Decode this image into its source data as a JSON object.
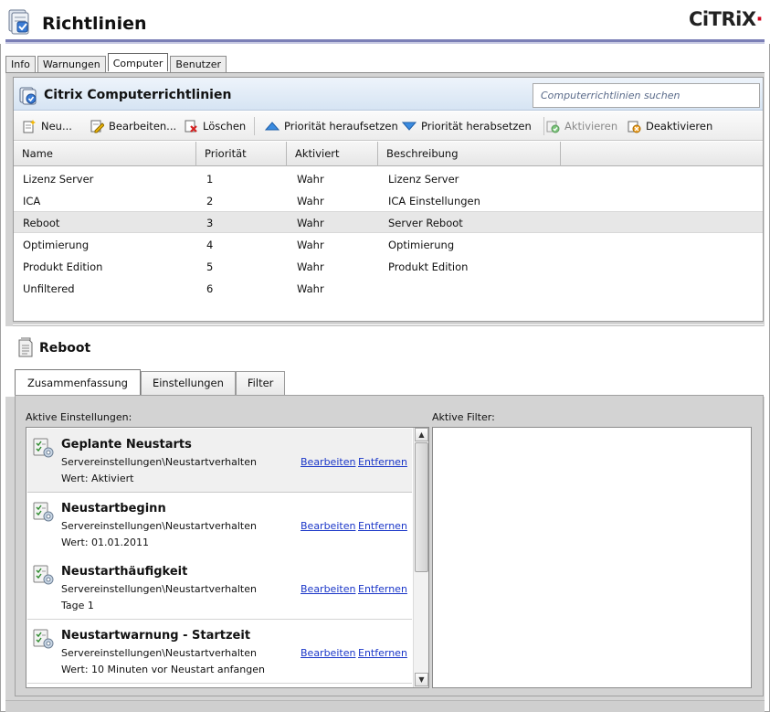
{
  "header": {
    "title": "Richtlinien",
    "logo_text": "CiTRiX",
    "logo_dot_color": "#d0021b"
  },
  "top_tabs": [
    {
      "label": "Info",
      "active": false
    },
    {
      "label": "Warnungen",
      "active": false
    },
    {
      "label": "Computer",
      "active": true
    },
    {
      "label": "Benutzer",
      "active": false
    }
  ],
  "policies_panel": {
    "title": "Citrix Computerrichtlinien",
    "search_placeholder": "Computerrichtlinien suchen",
    "toolbar": {
      "new": "Neu...",
      "edit": "Bearbeiten...",
      "delete": "Löschen",
      "raise_priority": "Priorität heraufsetzen",
      "lower_priority": "Priorität herabsetzen",
      "enable": "Aktivieren",
      "disable": "Deaktivieren"
    },
    "columns": [
      "Name",
      "Priorität",
      "Aktiviert",
      "Beschreibung"
    ],
    "rows": [
      {
        "name": "Lizenz Server",
        "priority": "1",
        "enabled": "Wahr",
        "description": "Lizenz Server"
      },
      {
        "name": "ICA",
        "priority": "2",
        "enabled": "Wahr",
        "description": "ICA Einstellungen"
      },
      {
        "name": "Reboot",
        "priority": "3",
        "enabled": "Wahr",
        "description": "Server Reboot"
      },
      {
        "name": "Optimierung",
        "priority": "4",
        "enabled": "Wahr",
        "description": "Optimierung"
      },
      {
        "name": "Produkt Edition",
        "priority": "5",
        "enabled": "Wahr",
        "description": "Produkt Edition"
      },
      {
        "name": "Unfiltered",
        "priority": "6",
        "enabled": "Wahr",
        "description": ""
      }
    ],
    "selected_row": "Reboot"
  },
  "detail": {
    "title": "Reboot",
    "tabs": [
      {
        "label": "Zusammenfassung",
        "active": true
      },
      {
        "label": "Einstellungen",
        "active": false
      },
      {
        "label": "Filter",
        "active": false
      }
    ],
    "active_settings_label": "Aktive Einstellungen:",
    "active_filters_label": "Aktive Filter:",
    "link_edit": "Bearbeiten",
    "link_remove": "Entfernen",
    "settings": [
      {
        "name": "Geplante Neustarts",
        "path": "Servereinstellungen\\Neustartverhalten",
        "value": "Wert: Aktiviert"
      },
      {
        "name": "Neustartbeginn",
        "path": "Servereinstellungen\\Neustartverhalten",
        "value": "Wert: 01.01.2011"
      },
      {
        "name": "Neustarthäufigkeit",
        "path": "Servereinstellungen\\Neustartverhalten",
        "value": "Tage 1"
      },
      {
        "name": "Neustartwarnung - Startzeit",
        "path": "Servereinstellungen\\Neustartverhalten",
        "value": "Wert: 10 Minuten vor Neustart anfangen"
      }
    ]
  }
}
